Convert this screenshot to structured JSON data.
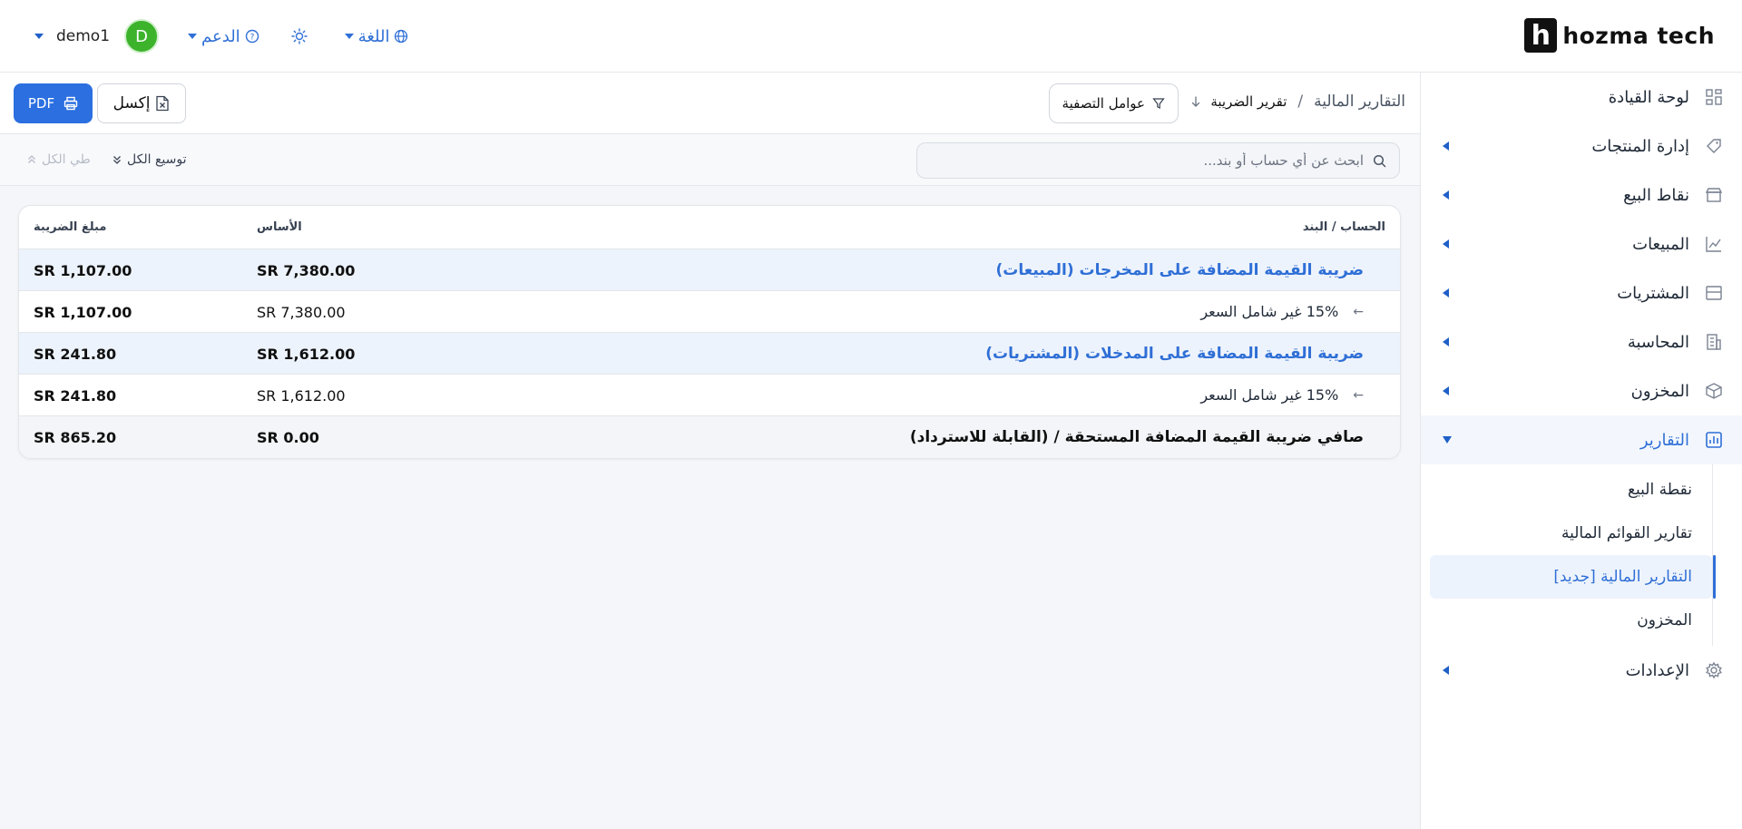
{
  "brand": {
    "name": "hozma tech",
    "mark": "h"
  },
  "header": {
    "username": "demo1",
    "avatar_initial": "D",
    "support_label": "الدعم",
    "language_label": "اللغة"
  },
  "sidebar": {
    "items": [
      {
        "label": "لوحة القيادة",
        "icon": "dashboard-icon"
      },
      {
        "label": "إدارة المنتجات",
        "icon": "tag-icon"
      },
      {
        "label": "نقاط البيع",
        "icon": "store-icon"
      },
      {
        "label": "المبيعات",
        "icon": "chart-line-icon"
      },
      {
        "label": "المشتريات",
        "icon": "inbox-icon"
      },
      {
        "label": "المحاسبة",
        "icon": "building-icon"
      },
      {
        "label": "المخزون",
        "icon": "box-icon"
      },
      {
        "label": "التقارير",
        "icon": "report-icon"
      },
      {
        "label": "الإعدادات",
        "icon": "gear-icon"
      }
    ],
    "reports_sub": [
      {
        "label": "نقطة البيع"
      },
      {
        "label": "تقارير القوائم المالية"
      },
      {
        "label": "التقارير المالية [جديد]"
      },
      {
        "label": "المخزون"
      }
    ]
  },
  "toolbar": {
    "breadcrumb_parent": "التقارير المالية",
    "breadcrumb_sep": "/",
    "breadcrumb_current": "تقرير الضريبة",
    "filter_label": "عوامل التصفية",
    "excel_label": "إكسل",
    "pdf_label": "PDF"
  },
  "search": {
    "placeholder": "ابحث عن أي حساب أو بند..."
  },
  "tree_controls": {
    "expand_label": "توسيع الكل",
    "collapse_label": "طي الكل"
  },
  "table": {
    "headers": {
      "account": "الحساب / البند",
      "base": "الأساس",
      "tax": "مبلغ الضريبة"
    },
    "rows": [
      {
        "type": "group",
        "account": "ضريبة القيمة المضافة على المخرجات (المبيعات)",
        "base": "SR 7,380.00",
        "tax": "SR 1,107.00"
      },
      {
        "type": "item",
        "account": "15% غير شامل السعر",
        "base": "SR 7,380.00",
        "tax": "SR 1,107.00"
      },
      {
        "type": "group",
        "account": "ضريبة القيمة المضافة على المدخلات (المشتريات)",
        "base": "SR 1,612.00",
        "tax": "SR 241.80"
      },
      {
        "type": "item",
        "account": "15% غير شامل السعر",
        "base": "SR 1,612.00",
        "tax": "SR 241.80"
      },
      {
        "type": "total",
        "account": "صافي ضريبة القيمة المضافة المستحقة / (القابلة للاسترداد)",
        "base": "SR 0.00",
        "tax": "SR 865.20"
      }
    ]
  },
  "colors": {
    "accent": "#2f6fd6",
    "pdf_button": "#2b6fe0",
    "avatar": "#3cb32b"
  }
}
